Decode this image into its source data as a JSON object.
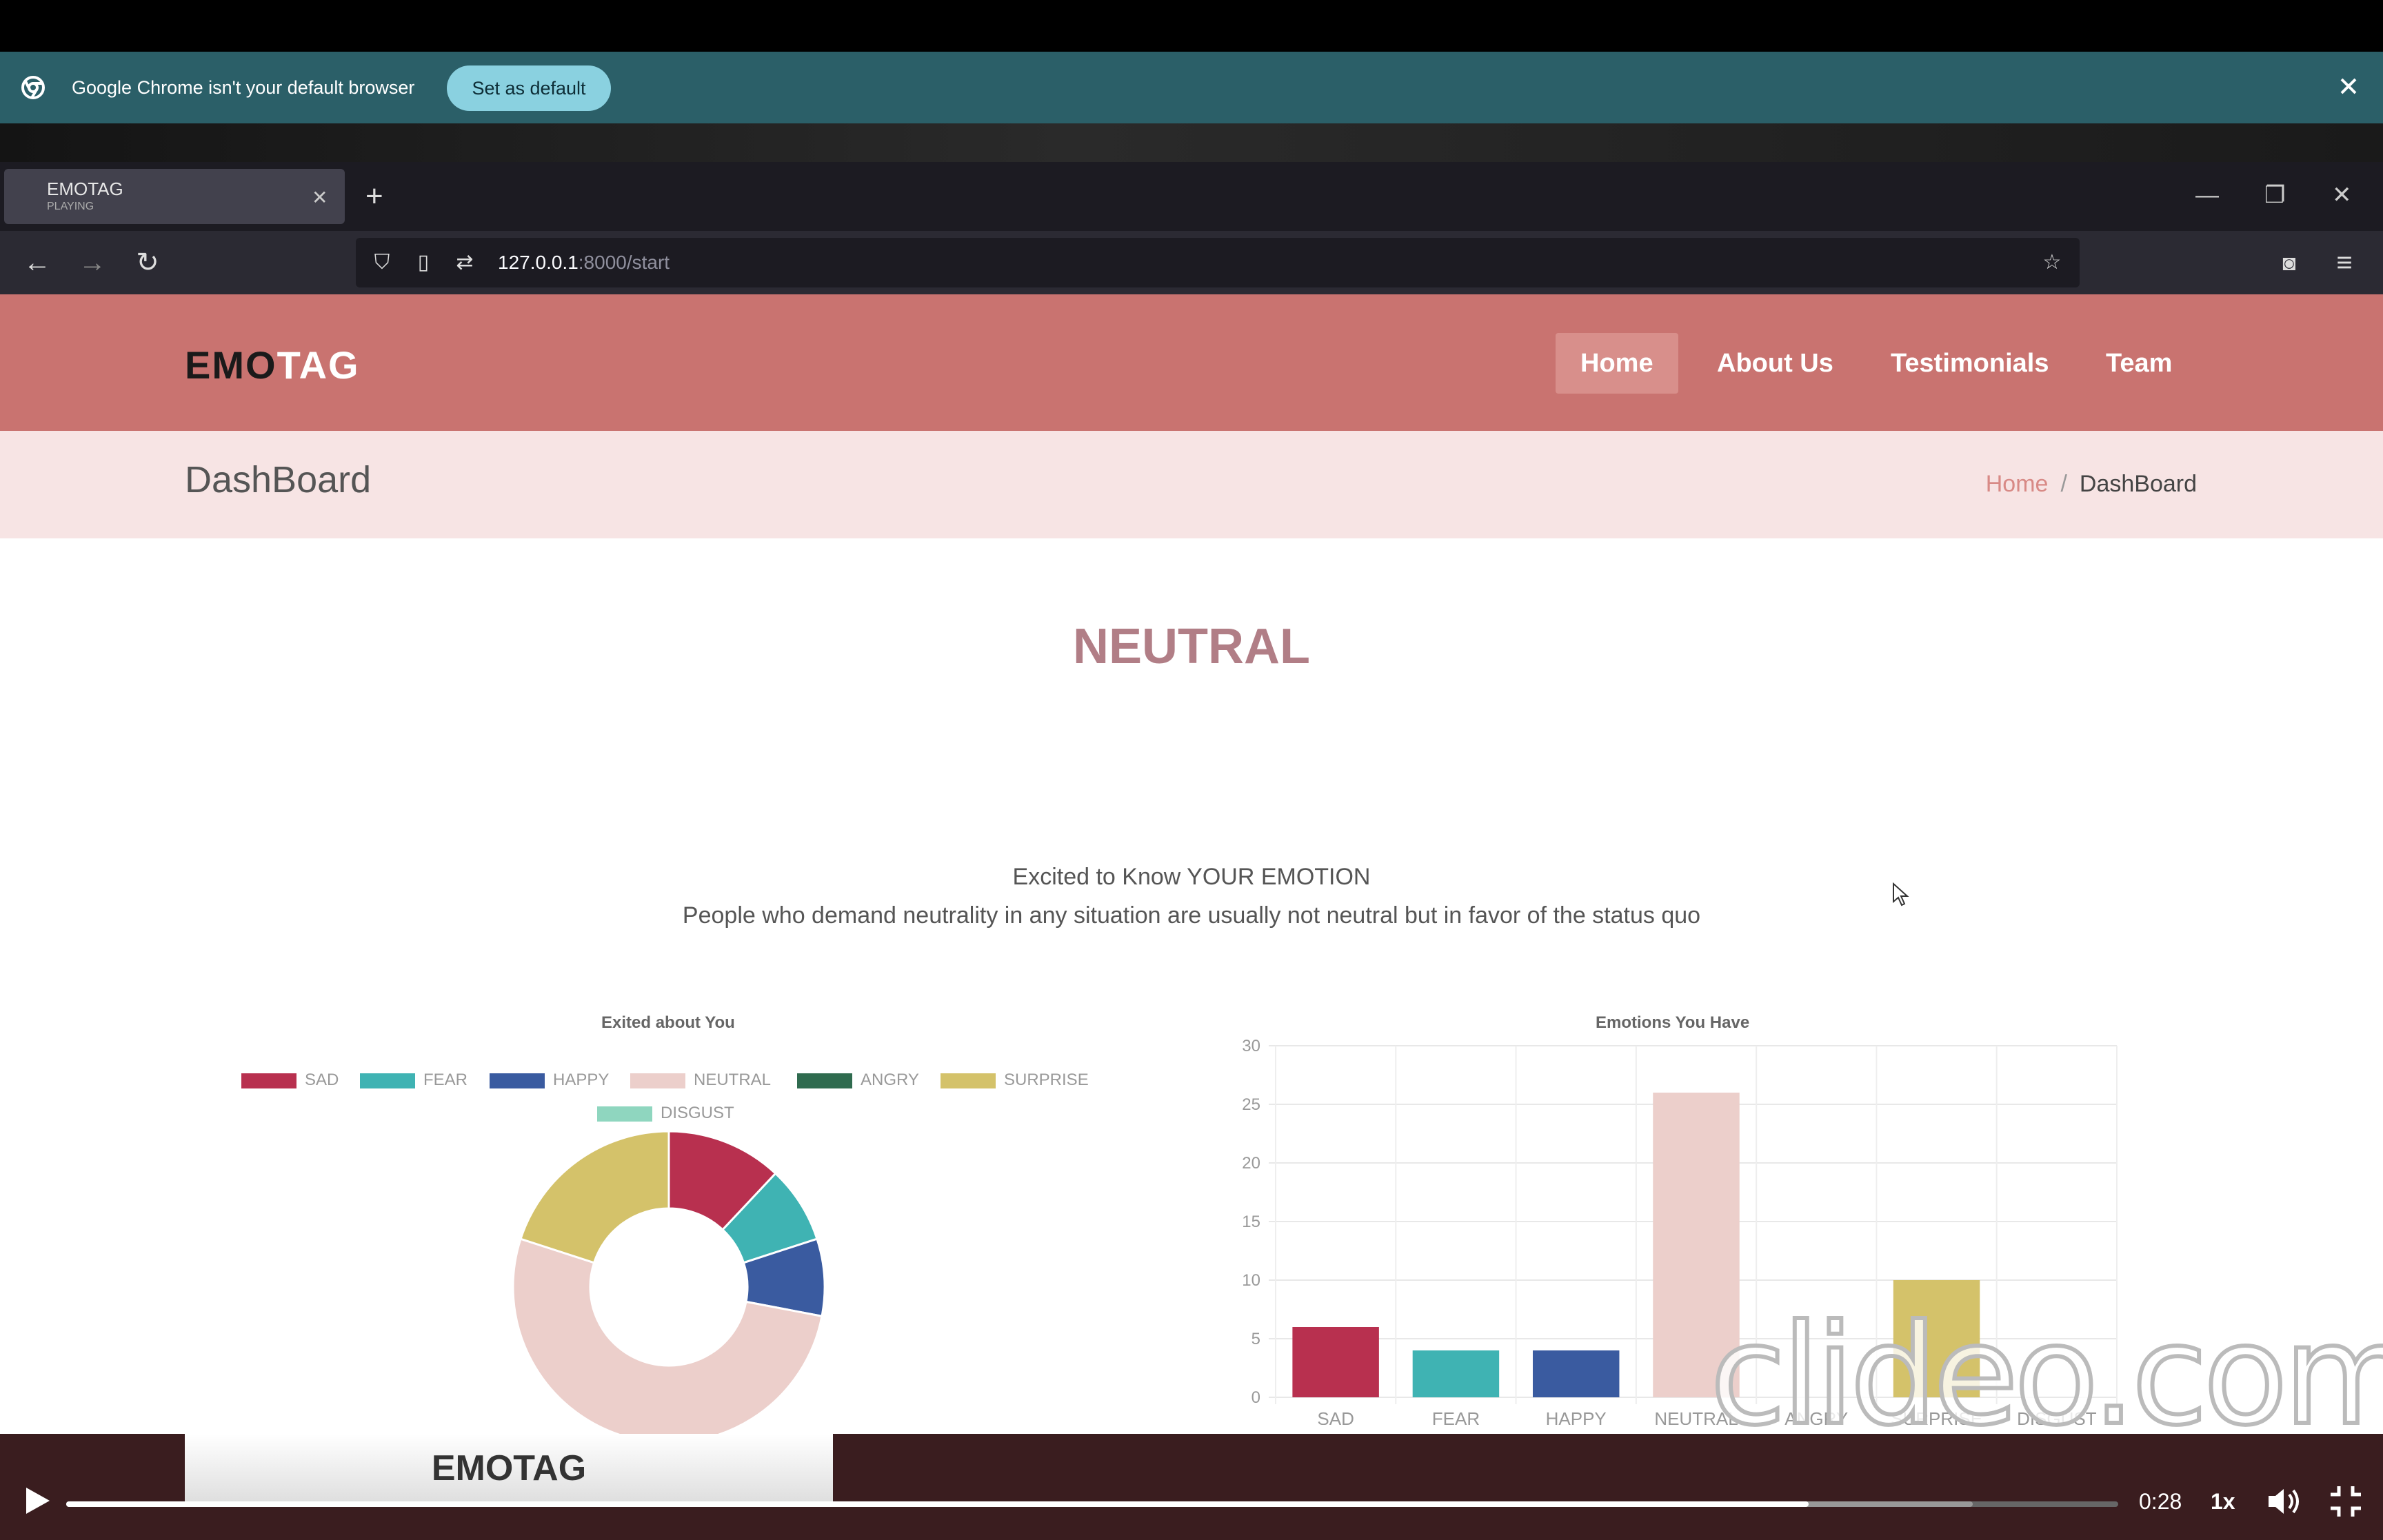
{
  "infobar": {
    "message": "Google Chrome isn't your default browser",
    "button": "Set as default",
    "icon": "chrome-icon"
  },
  "firefox": {
    "tab_title": "EMOTAG",
    "tab_subtitle": "PLAYING",
    "url_host": "127.0.0.1",
    "url_rest": ":8000/start"
  },
  "site": {
    "logo_a": "EMO",
    "logo_b": "TAG",
    "nav": [
      "Home",
      "About Us",
      "Testimonials",
      "Team"
    ],
    "page_title": "DashBoard",
    "crumb_home": "Home",
    "crumb_sep": "/",
    "crumb_current": "DashBoard",
    "emotion": "NEUTRAL",
    "tagline1": "Excited to Know YOUR EMOTION",
    "tagline2": "People who demand neutrality in any situation are usually not neutral but in favor of the status quo",
    "footer_card": "EMOTAG"
  },
  "chart_data": [
    {
      "type": "pie",
      "title": "Exited about You",
      "categories": [
        "SAD",
        "FEAR",
        "HAPPY",
        "NEUTRAL",
        "ANGRY",
        "SURPRISE",
        "DISGUST"
      ],
      "values": [
        6,
        4,
        4,
        26,
        0,
        10,
        0
      ],
      "colors": [
        "#b8304f",
        "#3fb3b3",
        "#3a5ba0",
        "#eccfcb",
        "#2f6b4f",
        "#d4c26a",
        "#8fd6bf"
      ],
      "legend": "top"
    },
    {
      "type": "bar",
      "title": "Emotions You Have",
      "categories": [
        "SAD",
        "FEAR",
        "HAPPY",
        "NEUTRAL",
        "ANGRY",
        "SURPRISE",
        "DISGUST"
      ],
      "values": [
        6,
        4,
        4,
        26,
        0,
        10,
        0
      ],
      "colors": [
        "#b8304f",
        "#3fb3b3",
        "#3a5ba0",
        "#eccfcb",
        "#2f6b4f",
        "#d4c26a",
        "#8fd6bf"
      ],
      "ylim": [
        0,
        30
      ],
      "yticks": [
        0,
        5,
        10,
        15,
        20,
        25,
        30
      ],
      "grid": true
    }
  ],
  "watermark": "clideo.com",
  "player": {
    "time": "0:28",
    "speed": "1x",
    "progress": 0.849,
    "buffered": 0.929
  }
}
